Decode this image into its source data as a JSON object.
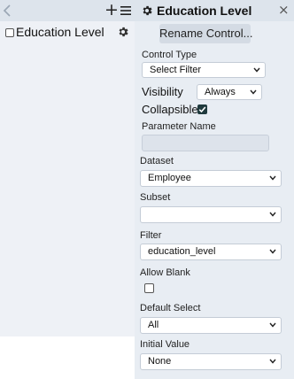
{
  "left": {
    "items": [
      {
        "label": "Education Level",
        "checked": false
      }
    ],
    "icons": {
      "back": "chevron-left-icon",
      "add": "plus-icon",
      "menu": "hamburger-menu-icon",
      "settings": "gear-icon"
    }
  },
  "panel": {
    "title": "Education Level",
    "rename_label": "Rename Control...",
    "control_type": {
      "label": "Control Type",
      "value": "Select Filter"
    },
    "visibility": {
      "label": "Visibility",
      "value": "Always"
    },
    "collapsible": {
      "label": "Collapsible",
      "checked": true
    },
    "parameter_name": {
      "label": "Parameter Name",
      "value": ""
    },
    "dataset": {
      "label": "Dataset",
      "value": "Employee"
    },
    "subset": {
      "label": "Subset",
      "value": ""
    },
    "filter": {
      "label": "Filter",
      "value": "education_level"
    },
    "allow_blank": {
      "label": "Allow Blank",
      "checked": false
    },
    "default_select": {
      "label": "Default Select",
      "value": "All"
    },
    "initial_value": {
      "label": "Initial Value",
      "value": "None"
    }
  },
  "colors": {
    "toolbar_bg": "#dde4ec",
    "list_bg": "#eef1f6",
    "panel_bg": "#e8edf3",
    "checked_box": "#1f3a3d"
  }
}
